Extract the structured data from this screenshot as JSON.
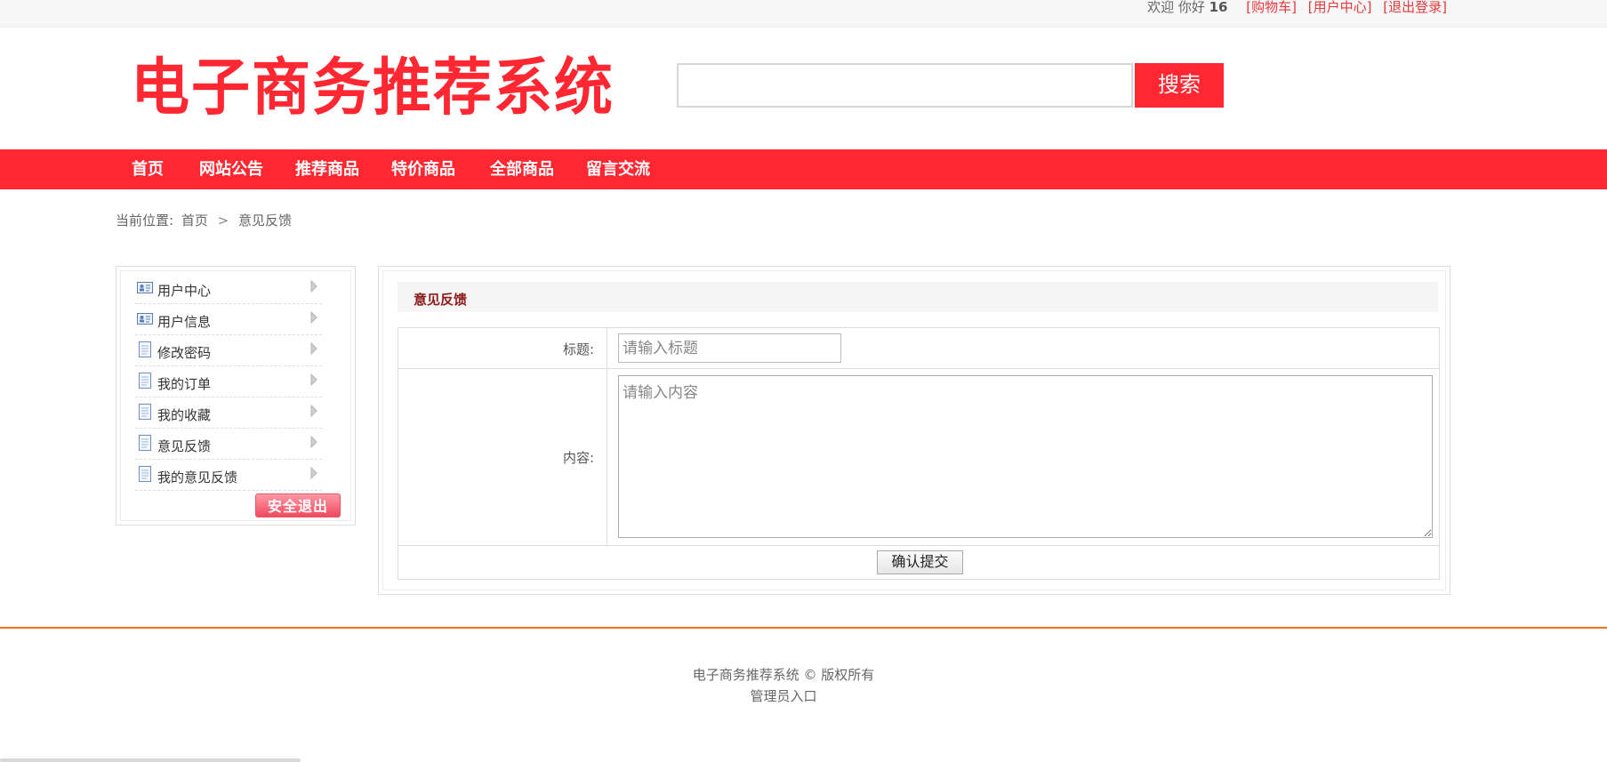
{
  "topbar": {
    "welcome": "欢迎 你好",
    "username": "16",
    "cart_link": "[购物车]",
    "user_center_link": "[用户中心]",
    "logout_link": "[退出登录]"
  },
  "header": {
    "logo_text": "电子商务推荐系统",
    "search_placeholder": "",
    "search_button": "搜索"
  },
  "nav": {
    "items": [
      {
        "label": "首页"
      },
      {
        "label": "网站公告"
      },
      {
        "label": "推荐商品"
      },
      {
        "label": "特价商品"
      },
      {
        "label": "全部商品"
      },
      {
        "label": "留言交流"
      }
    ]
  },
  "breadcrumb": {
    "prefix": "当前位置:",
    "home": "首页",
    "separator": ">",
    "current": "意见反馈"
  },
  "sidebar": {
    "items": [
      {
        "label": "用户中心",
        "icon": "id-card-icon"
      },
      {
        "label": "用户信息",
        "icon": "id-card-icon"
      },
      {
        "label": "修改密码",
        "icon": "document-icon"
      },
      {
        "label": "我的订单",
        "icon": "document-icon"
      },
      {
        "label": "我的收藏",
        "icon": "document-icon"
      },
      {
        "label": "意见反馈",
        "icon": "document-icon"
      },
      {
        "label": "我的意见反馈",
        "icon": "document-icon"
      }
    ],
    "logout_button": "安全退出"
  },
  "panel": {
    "title": "意见反馈",
    "title_label": "标题:",
    "title_placeholder": "请输入标题",
    "content_label": "内容:",
    "content_placeholder": "请输入内容",
    "submit_button": "确认提交"
  },
  "footer": {
    "copyright": "电子商务推荐系统 © 版权所有",
    "admin_link": "管理员入口"
  },
  "colors": {
    "brand_red": "#ff2832",
    "footer_line": "#ff6a28",
    "panel_title": "#8b1a1a"
  }
}
